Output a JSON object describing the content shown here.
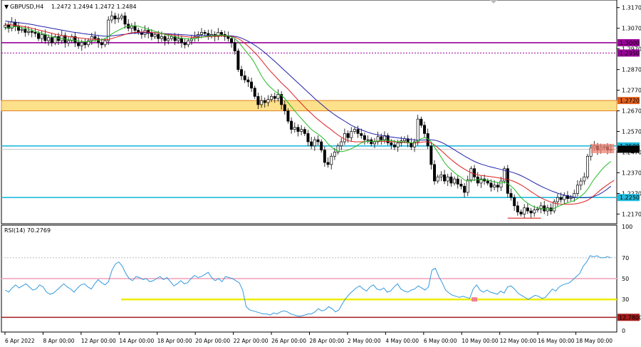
{
  "header": {
    "symbol_label": "GBPUSD,H4",
    "ohlc_label": "1.2472 1.2494 1.2472 1.2484"
  },
  "rsi_header": {
    "label": "RSI(14) 70.2769"
  },
  "colors": {
    "bull_candle": "#ffffff",
    "bear_candle": "#000000",
    "ma_fast": "#22bb22",
    "ma_mid": "#dd2222",
    "ma_slow": "#2222aa",
    "rsi_line": "#3399dd",
    "level_purple": "#990099",
    "level_cyan": "#22bbdd",
    "zone_fill": "#fce08a",
    "zone_border": "#e08020",
    "rsi_yellow": "#eeee00",
    "rsi_pink": "#f4b6c8",
    "rsi_maroon": "#a31b1b"
  },
  "chart_data": {
    "type": "candlestick",
    "price_axis": {
      "ylim": [
        1.213,
        1.32
      ],
      "ticks": [
        "1.3170",
        "1.3070",
        "1.2970",
        "1.2870",
        "1.2770",
        "1.2670",
        "1.2570",
        "1.2470",
        "1.2370",
        "1.2270",
        "1.2170"
      ]
    },
    "time_axis": {
      "labels": [
        "6 Apr 2022",
        "8 Apr 00:00",
        "12 Apr 00:00",
        "14 Apr 00:00",
        "18 Apr 00:00",
        "20 Apr 00:00",
        "22 Apr 00:00",
        "26 Apr 00:00",
        "28 Apr 00:00",
        "2 May 00:00",
        "4 May 00:00",
        "6 May 00:00",
        "10 May 00:00",
        "12 May 00:00",
        "16 May 00:00",
        "18 May 00:00"
      ]
    },
    "levels": [
      {
        "value": 1.3,
        "label": "1.3000",
        "style": "solid-purple"
      },
      {
        "value": 1.295,
        "label": "1.2950",
        "style": "dotted-purple"
      },
      {
        "value": 1.25,
        "label": "1.2500",
        "style": "solid-cyan"
      },
      {
        "value": 1.225,
        "label": "1.2250",
        "style": "solid-cyan"
      }
    ],
    "zone": {
      "from": 1.267,
      "to": 1.272,
      "label": "1.2720"
    },
    "current_price": {
      "value": 1.2484,
      "label": "1.2484"
    },
    "close": [
      1.3085,
      1.307,
      1.31,
      1.308,
      1.306,
      1.3065,
      1.305,
      1.3055,
      1.305,
      1.3045,
      1.302,
      1.304,
      1.301,
      1.3025,
      1.3,
      1.303,
      1.301,
      1.3035,
      1.3,
      1.301,
      1.303,
      1.3,
      1.2985,
      1.3,
      1.299,
      1.301,
      1.303,
      1.302,
      1.3,
      1.299,
      1.301,
      1.311,
      1.313,
      1.3115,
      1.312,
      1.313,
      1.309,
      1.307,
      1.308,
      1.306,
      1.305,
      1.304,
      1.306,
      1.3045,
      1.303,
      1.304,
      1.302,
      1.303,
      1.301,
      1.302,
      1.303,
      1.301,
      1.302,
      1.3,
      1.299,
      1.301,
      1.302,
      1.303,
      1.304,
      1.305,
      1.3045,
      1.3035,
      1.304,
      1.303,
      1.305,
      1.304,
      1.303,
      1.302,
      1.3,
      1.296,
      1.287,
      1.284,
      1.282,
      1.281,
      1.278,
      1.274,
      1.27,
      1.272,
      1.271,
      1.2725,
      1.274,
      1.273,
      1.275,
      1.27,
      1.267,
      1.262,
      1.258,
      1.259,
      1.257,
      1.258,
      1.256,
      1.252,
      1.25,
      1.253,
      1.252,
      1.248,
      1.242,
      1.241,
      1.245,
      1.247,
      1.25,
      1.252,
      1.256,
      1.254,
      1.257,
      1.258,
      1.256,
      1.255,
      1.253,
      1.253,
      1.251,
      1.252,
      1.2545,
      1.253,
      1.255,
      1.2515,
      1.2505,
      1.2495,
      1.2515,
      1.2525,
      1.2535,
      1.2515,
      1.2495,
      1.252,
      1.263,
      1.26,
      1.256,
      1.25,
      1.241,
      1.233,
      1.235,
      1.236,
      1.233,
      1.235,
      1.232,
      1.234,
      1.2315,
      1.2305,
      1.2275,
      1.2335,
      1.239,
      1.235,
      1.232,
      1.234,
      1.233,
      1.232,
      1.23,
      1.231,
      1.23,
      1.233,
      1.239,
      1.227,
      1.225,
      1.221,
      1.218,
      1.217,
      1.22,
      1.2185,
      1.2175,
      1.219,
      1.2195,
      1.221,
      1.2185,
      1.22,
      1.2185,
      1.223,
      1.225,
      1.224,
      1.226,
      1.2245,
      1.225,
      1.227,
      1.231,
      1.233,
      1.235,
      1.245,
      1.249,
      1.25,
      1.248,
      1.249,
      1.2495,
      1.248,
      1.2484
    ],
    "ma_fast": [
      1.307,
      1.3073,
      1.3076,
      1.3078,
      1.3076,
      1.3073,
      1.307,
      1.3066,
      1.306,
      1.3055,
      1.305,
      1.3045,
      1.304,
      1.3035,
      1.303,
      1.3025,
      1.3022,
      1.302,
      1.3018,
      1.3015,
      1.3012,
      1.301,
      1.3008,
      1.3005,
      1.3005,
      1.3005,
      1.3007,
      1.301,
      1.3012,
      1.3015,
      1.302,
      1.303,
      1.3042,
      1.3052,
      1.306,
      1.3068,
      1.3075,
      1.308,
      1.3082,
      1.3082,
      1.308,
      1.3075,
      1.307,
      1.3065,
      1.306,
      1.3055,
      1.305,
      1.3045,
      1.304,
      1.3035,
      1.3032,
      1.3028,
      1.3025,
      1.3022,
      1.302,
      1.3018,
      1.3018,
      1.302,
      1.3023,
      1.3027,
      1.303,
      1.3032,
      1.3034,
      1.3035,
      1.3036,
      1.3036,
      1.3035,
      1.3033,
      1.3028,
      1.302,
      1.3005,
      1.2985,
      1.2965,
      1.2945,
      1.2925,
      1.29,
      1.287,
      1.284,
      1.2815,
      1.2795,
      1.278,
      1.2765,
      1.2755,
      1.2745,
      1.273,
      1.271,
      1.269,
      1.267,
      1.265,
      1.2632,
      1.2615,
      1.2597,
      1.258,
      1.2568,
      1.2558,
      1.2545,
      1.253,
      1.251,
      1.2495,
      1.2482,
      1.2475,
      1.2472,
      1.2475,
      1.248,
      1.2487,
      1.2495,
      1.2505,
      1.2515,
      1.252,
      1.2522,
      1.2522,
      1.2522,
      1.2524,
      1.2526,
      1.2528,
      1.2528,
      1.2526,
      1.2522,
      1.252,
      1.252,
      1.252,
      1.2518,
      1.2515,
      1.2516,
      1.2525,
      1.2535,
      1.254,
      1.2535,
      1.252,
      1.2495,
      1.247,
      1.2445,
      1.242,
      1.24,
      1.2385,
      1.237,
      1.2358,
      1.2348,
      1.2335,
      1.233,
      1.2332,
      1.2335,
      1.2336,
      1.2337,
      1.2336,
      1.2334,
      1.233,
      1.2326,
      1.2322,
      1.232,
      1.2325,
      1.2318,
      1.2305,
      1.229,
      1.227,
      1.225,
      1.2235,
      1.2222,
      1.2212,
      1.2205,
      1.22,
      1.2198,
      1.2195,
      1.2194,
      1.2192,
      1.2198,
      1.2206,
      1.2212,
      1.222,
      1.2225,
      1.223,
      1.2235,
      1.2245,
      1.2257,
      1.227,
      1.229,
      1.2315,
      1.234,
      1.236,
      1.238,
      1.2398,
      1.2412,
      1.2425
    ],
    "ma_mid": [
      1.309,
      1.3088,
      1.3086,
      1.3084,
      1.3082,
      1.308,
      1.3077,
      1.3074,
      1.307,
      1.3066,
      1.3062,
      1.3058,
      1.3054,
      1.305,
      1.3046,
      1.3042,
      1.3038,
      1.3035,
      1.3032,
      1.303,
      1.3028,
      1.3026,
      1.3024,
      1.3022,
      1.302,
      1.3018,
      1.3017,
      1.3016,
      1.3015,
      1.3014,
      1.3014,
      1.3016,
      1.302,
      1.3025,
      1.303,
      1.3035,
      1.304,
      1.3045,
      1.3048,
      1.305,
      1.3051,
      1.3052,
      1.3052,
      1.3051,
      1.305,
      1.3048,
      1.3046,
      1.3044,
      1.3042,
      1.304,
      1.3038,
      1.3036,
      1.3034,
      1.3032,
      1.303,
      1.3028,
      1.3027,
      1.3026,
      1.3026,
      1.3027,
      1.3028,
      1.3029,
      1.303,
      1.3031,
      1.3032,
      1.3033,
      1.3033,
      1.3032,
      1.303,
      1.3027,
      1.302,
      1.301,
      1.2997,
      1.2983,
      1.2968,
      1.2952,
      1.2935,
      1.2915,
      1.2895,
      1.2875,
      1.2857,
      1.284,
      1.2822,
      1.2805,
      1.279,
      1.2775,
      1.2758,
      1.274,
      1.2722,
      1.2705,
      1.2688,
      1.2672,
      1.2657,
      1.2642,
      1.2628,
      1.2615,
      1.2602,
      1.259,
      1.2578,
      1.2565,
      1.2553,
      1.2542,
      1.2533,
      1.2526,
      1.2522,
      1.252,
      1.252,
      1.252,
      1.2521,
      1.2522,
      1.2522,
      1.2522,
      1.2522,
      1.2522,
      1.2522,
      1.2522,
      1.2521,
      1.252,
      1.2519,
      1.2518,
      1.2517,
      1.2516,
      1.2515,
      1.2514,
      1.2515,
      1.2518,
      1.252,
      1.252,
      1.2515,
      1.2505,
      1.2492,
      1.2478,
      1.2463,
      1.2448,
      1.2434,
      1.2421,
      1.2409,
      1.2398,
      1.2388,
      1.2378,
      1.237,
      1.2364,
      1.236,
      1.2357,
      1.2355,
      1.2353,
      1.2351,
      1.2349,
      1.2346,
      1.2343,
      1.234,
      1.2338,
      1.2333,
      1.2327,
      1.232,
      1.2311,
      1.2301,
      1.229,
      1.2279,
      1.2268,
      1.2258,
      1.2249,
      1.2241,
      1.2234,
      1.2228,
      1.2223,
      1.222,
      1.2218,
      1.2217,
      1.2217,
      1.2218,
      1.2219,
      1.2221,
      1.2225,
      1.223,
      1.2237,
      1.2247,
      1.226,
      1.2274,
      1.2288,
      1.23,
      1.2312,
      1.2323,
      1.2333
    ],
    "ma_slow": [
      1.3105,
      1.3103,
      1.3101,
      1.3099,
      1.3097,
      1.3095,
      1.3093,
      1.3091,
      1.3088,
      1.3085,
      1.3082,
      1.3079,
      1.3076,
      1.3073,
      1.307,
      1.3067,
      1.3064,
      1.3061,
      1.3058,
      1.3055,
      1.3052,
      1.305,
      1.3048,
      1.3045,
      1.3043,
      1.3041,
      1.3039,
      1.3037,
      1.3035,
      1.3033,
      1.3032,
      1.3032,
      1.3033,
      1.3035,
      1.3037,
      1.3039,
      1.3041,
      1.3043,
      1.3045,
      1.3046,
      1.3047,
      1.3048,
      1.3048,
      1.3048,
      1.3048,
      1.3047,
      1.3046,
      1.3045,
      1.3044,
      1.3043,
      1.3042,
      1.3041,
      1.304,
      1.3039,
      1.3038,
      1.3037,
      1.3036,
      1.3035,
      1.3035,
      1.3035,
      1.3035,
      1.3035,
      1.3035,
      1.3035,
      1.3035,
      1.3035,
      1.3035,
      1.3034,
      1.3033,
      1.3031,
      1.3028,
      1.3022,
      1.3015,
      1.3007,
      1.2998,
      1.2988,
      1.2977,
      1.2965,
      1.2952,
      1.2938,
      1.2924,
      1.291,
      1.2895,
      1.288,
      1.2865,
      1.285,
      1.2835,
      1.282,
      1.2805,
      1.279,
      1.2775,
      1.276,
      1.2745,
      1.273,
      1.2716,
      1.2702,
      1.2688,
      1.2675,
      1.2663,
      1.2651,
      1.264,
      1.263,
      1.262,
      1.261,
      1.26,
      1.2592,
      1.2585,
      1.2578,
      1.2572,
      1.2566,
      1.2561,
      1.2557,
      1.2554,
      1.2551,
      1.2548,
      1.2545,
      1.2543,
      1.2541,
      1.2539,
      1.2537,
      1.2535,
      1.2533,
      1.2531,
      1.2529,
      1.2528,
      1.2528,
      1.2529,
      1.253,
      1.253,
      1.2528,
      1.2524,
      1.2518,
      1.251,
      1.2501,
      1.2491,
      1.2481,
      1.2471,
      1.2461,
      1.2451,
      1.2442,
      1.2433,
      1.2425,
      1.2418,
      1.2412,
      1.2407,
      1.2402,
      1.2398,
      1.2394,
      1.239,
      1.2386,
      1.2382,
      1.2378,
      1.2374,
      1.2369,
      1.2363,
      1.2356,
      1.2348,
      1.234,
      1.2331,
      1.2322,
      1.2313,
      1.2305,
      1.2297,
      1.229,
      1.2283,
      1.2277,
      1.2271,
      1.2266,
      1.2262,
      1.2258,
      1.2255,
      1.2252,
      1.225,
      1.2249,
      1.2249,
      1.225,
      1.2252,
      1.2256,
      1.2262,
      1.227,
      1.228,
      1.2292,
      1.2305
    ],
    "rsi": {
      "label": "RSI(14) 70.2769",
      "ylim": [
        0,
        100
      ],
      "ticks": [
        "100",
        "70",
        "50",
        "30",
        "0"
      ],
      "levels": [
        {
          "value": 50,
          "style": "pink"
        },
        {
          "value": 30,
          "style": "yellow"
        }
      ],
      "marker_label": "12.7800",
      "values": [
        39,
        37,
        41,
        44,
        41,
        43,
        45,
        42,
        39,
        40,
        44,
        42,
        37,
        35,
        36,
        39,
        42,
        45,
        42,
        40,
        37,
        41,
        44,
        45,
        42,
        40,
        45,
        49,
        46,
        44,
        47,
        58,
        64,
        66,
        62,
        55,
        50,
        48,
        52,
        51,
        49,
        50,
        47,
        48,
        50,
        52,
        49,
        51,
        47,
        43,
        45,
        48,
        45,
        46,
        50,
        53,
        51,
        52,
        54,
        56,
        51,
        48,
        50,
        47,
        52,
        51,
        50,
        48,
        46,
        39,
        23,
        20,
        19,
        18,
        17,
        16,
        16,
        15,
        17,
        16,
        18,
        19,
        18,
        16,
        15,
        14,
        14,
        15,
        16,
        16,
        18,
        21,
        19,
        20,
        23,
        21,
        18,
        20,
        26,
        31,
        35,
        38,
        41,
        43,
        40,
        38,
        42,
        44,
        40,
        39,
        41,
        37,
        38,
        42,
        45,
        40,
        38,
        37,
        39,
        40,
        43,
        41,
        39,
        42,
        58,
        60,
        52,
        46,
        39,
        36,
        34,
        33,
        32,
        33,
        32,
        31,
        40,
        44,
        39,
        37,
        39,
        37,
        36,
        35,
        38,
        36,
        42,
        43,
        40,
        36,
        34,
        32,
        30,
        32,
        34,
        33,
        31,
        32,
        36,
        40,
        38,
        42,
        44,
        45,
        46,
        49,
        52,
        55,
        62,
        66,
        72,
        71,
        72,
        70,
        70,
        71,
        70
      ]
    }
  }
}
